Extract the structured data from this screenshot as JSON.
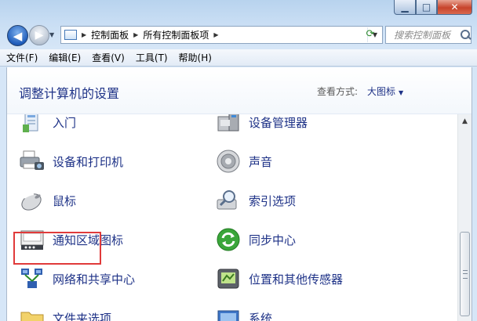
{
  "window": {
    "min_glyph": "▁",
    "max_glyph": "□",
    "close_glyph": "✕"
  },
  "nav": {
    "back_glyph": "◀",
    "forward_glyph": "▶",
    "breadcrumbs": [
      "控制面板",
      "所有控制面板项"
    ],
    "search_placeholder": "搜索控制面板"
  },
  "menu": [
    "文件(F)",
    "编辑(E)",
    "查看(V)",
    "工具(T)",
    "帮助(H)"
  ],
  "header": {
    "title": "调整计算机的设置",
    "view_by_label": "查看方式:",
    "view_by_value": "大图标"
  },
  "items": {
    "left": [
      "入门",
      "设备和打印机",
      "鼠标",
      "通知区域图标",
      "网络和共享中心",
      "文件夹选项"
    ],
    "right": [
      "设备管理器",
      "声音",
      "索引选项",
      "同步中心",
      "位置和其他传感器",
      "系统"
    ]
  },
  "selected_item": "鼠标"
}
